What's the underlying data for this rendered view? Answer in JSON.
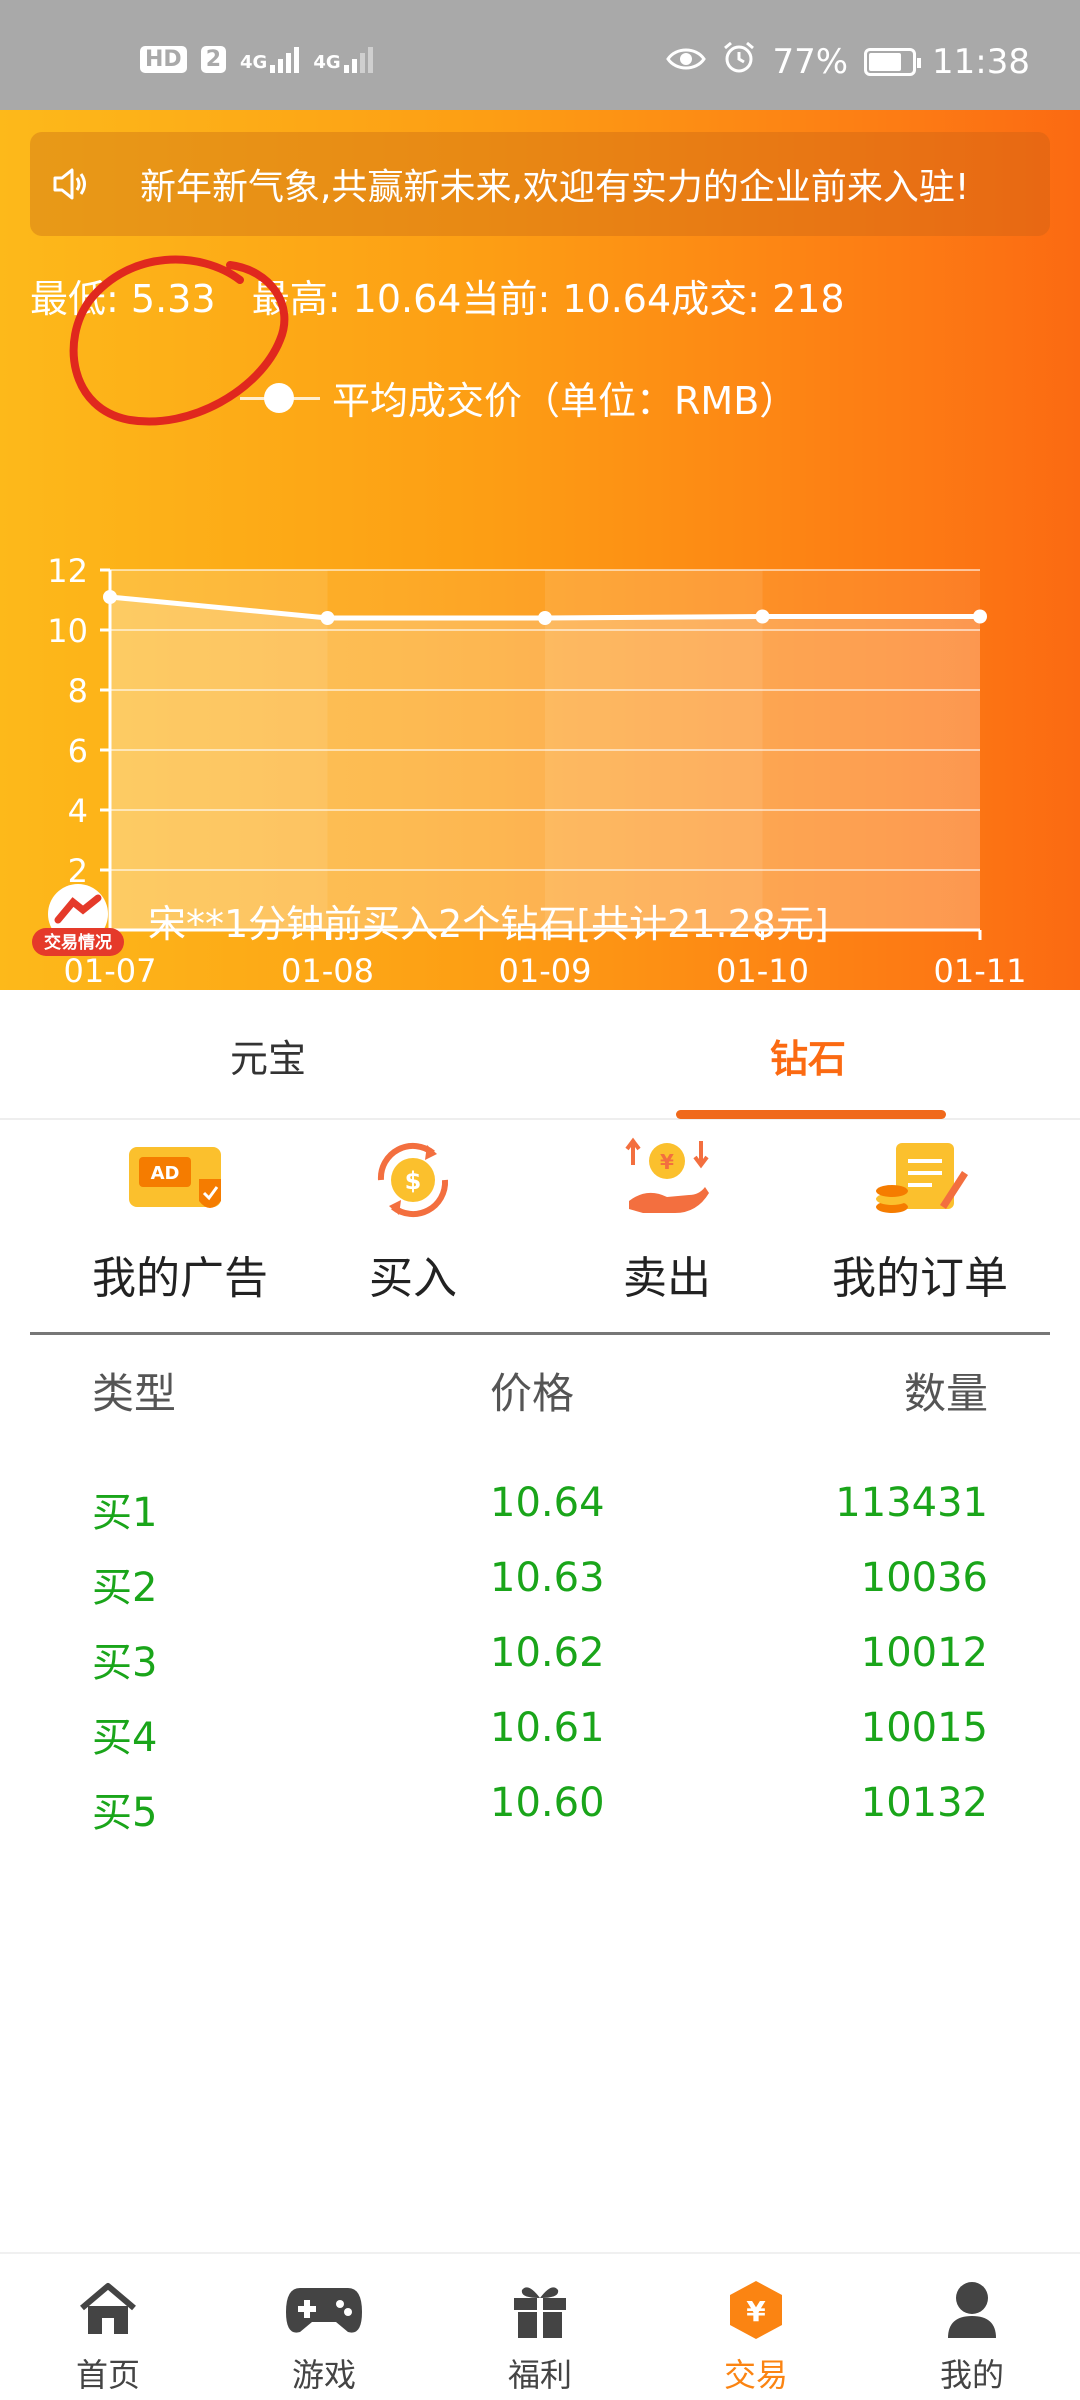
{
  "status_bar": {
    "hd_label": "HD",
    "sim_label": "2",
    "net1": "4G",
    "net2": "4G",
    "battery": "77%",
    "battery_level": 0.77,
    "time": "11:38",
    "icons": [
      "eye-icon",
      "alarm-icon",
      "leaf-battery-icon"
    ]
  },
  "notice": {
    "icon": "speaker-icon",
    "text": "新年新气象,共赢新未来,欢迎有实力的企业前来入驻!"
  },
  "stats": {
    "low_label": "最低:",
    "low_value": "5.33",
    "high_label": "最高:",
    "high_value": "10.64",
    "current_label": "当前:",
    "current_value": "10.64",
    "deal_label": "成交:",
    "deal_value": "218"
  },
  "chart_data": {
    "type": "line",
    "legend_label": "平均成交价（单位：RMB）",
    "categories": [
      "01-07",
      "01-08",
      "01-09",
      "01-10",
      "01-11"
    ],
    "series": [
      {
        "name": "平均成交价（单位：RMB）",
        "values": [
          11.1,
          10.4,
          10.4,
          10.45,
          10.45
        ]
      }
    ],
    "ylim": [
      0,
      12
    ],
    "yticks": [
      0,
      2,
      4,
      6,
      8,
      10,
      12
    ],
    "grid": true,
    "legend_position": "top-center"
  },
  "trade_feed": {
    "badge_label": "交易情况",
    "text": "宋**1分钟前买入2个钻石[共计21.28元]"
  },
  "tabs": [
    {
      "label": "元宝",
      "active": false
    },
    {
      "label": "钻石",
      "active": true
    }
  ],
  "actions": [
    {
      "label": "我的广告",
      "icon": "ad-icon"
    },
    {
      "label": "买入",
      "icon": "coin-exchange-icon"
    },
    {
      "label": "卖出",
      "icon": "hand-coin-icon"
    },
    {
      "label": "我的订单",
      "icon": "order-list-icon"
    }
  ],
  "order_table": {
    "headers": [
      "类型",
      "价格",
      "数量"
    ],
    "rows": [
      {
        "type": "买1",
        "price": "10.64",
        "qty": "113431"
      },
      {
        "type": "买2",
        "price": "10.63",
        "qty": "10036"
      },
      {
        "type": "买3",
        "price": "10.62",
        "qty": "10012"
      },
      {
        "type": "买4",
        "price": "10.61",
        "qty": "10015"
      },
      {
        "type": "买5",
        "price": "10.60",
        "qty": "10132"
      }
    ]
  },
  "bottom_nav": [
    {
      "label": "首页",
      "icon": "home-icon",
      "active": false
    },
    {
      "label": "游戏",
      "icon": "gamepad-icon",
      "active": false
    },
    {
      "label": "福利",
      "icon": "gift-icon",
      "active": false
    },
    {
      "label": "交易",
      "icon": "yuan-hexagon-icon",
      "active": true
    },
    {
      "label": "我的",
      "icon": "user-icon",
      "active": false
    }
  ],
  "colors": {
    "accent": "#fb6a12",
    "buy_green": "#1aa51a",
    "header_start": "#fdb91a",
    "header_end": "#fb6a12",
    "annotation_red": "#e0281e"
  }
}
